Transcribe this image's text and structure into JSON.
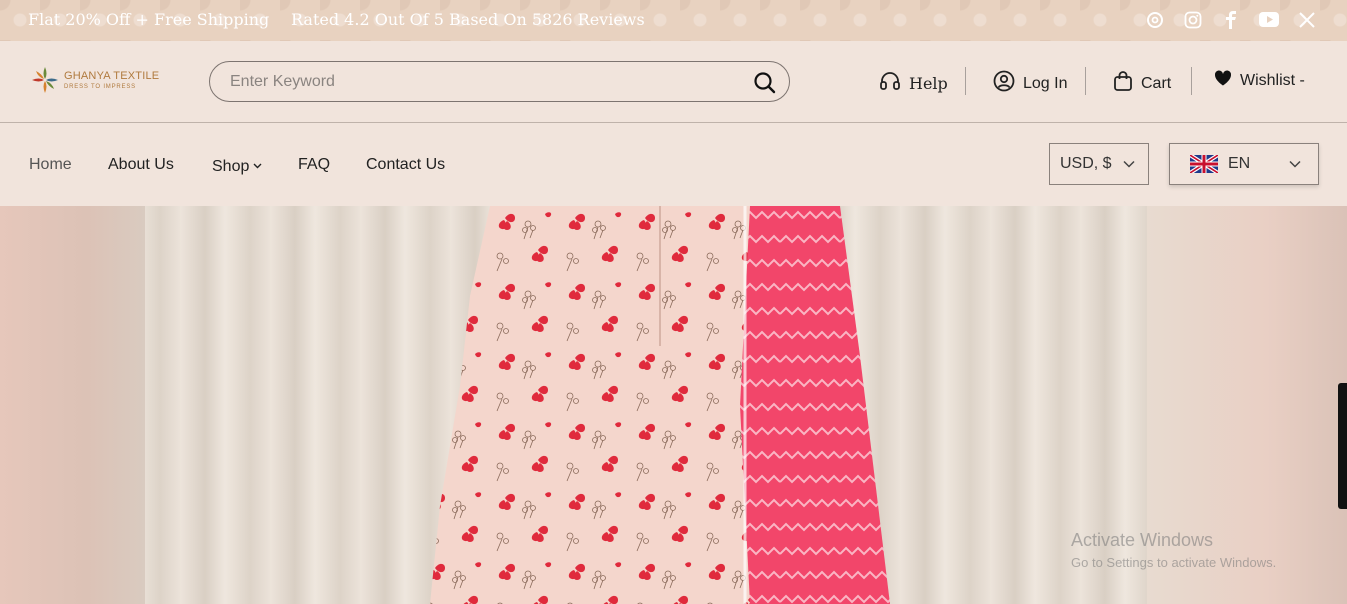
{
  "announcement": {
    "left_text": "Flat 20% Off + Free Shipping",
    "right_text": "Rated 4.2 Out Of 5 Based On 5826 Reviews",
    "social_icons": [
      "threads-icon",
      "instagram-icon",
      "facebook-icon",
      "youtube-icon",
      "x-icon"
    ]
  },
  "header": {
    "logo": {
      "brand": "GHANYA TEXTILE",
      "tagline": "DRESS TO IMPRESS"
    },
    "search": {
      "placeholder": "Enter Keyword",
      "value": ""
    },
    "help_label": "Help",
    "login_label": "Log In",
    "cart_label": "Cart",
    "wishlist_label": "Wishlist -"
  },
  "nav": {
    "items": [
      {
        "label": "Home"
      },
      {
        "label": "About Us"
      },
      {
        "label": "Shop"
      },
      {
        "label": "FAQ"
      },
      {
        "label": "Contact Us"
      }
    ],
    "currency": "USD, $",
    "language": "EN"
  },
  "overlay": {
    "activate_title": "Activate Windows",
    "activate_sub": "Go to Settings to activate Windows."
  },
  "colors": {
    "accent": "#e8d2c0",
    "brand": "#b07a3e",
    "background": "#f1e4dc",
    "dress_red": "#e02a3c",
    "scarf_pink": "#f2466a"
  }
}
